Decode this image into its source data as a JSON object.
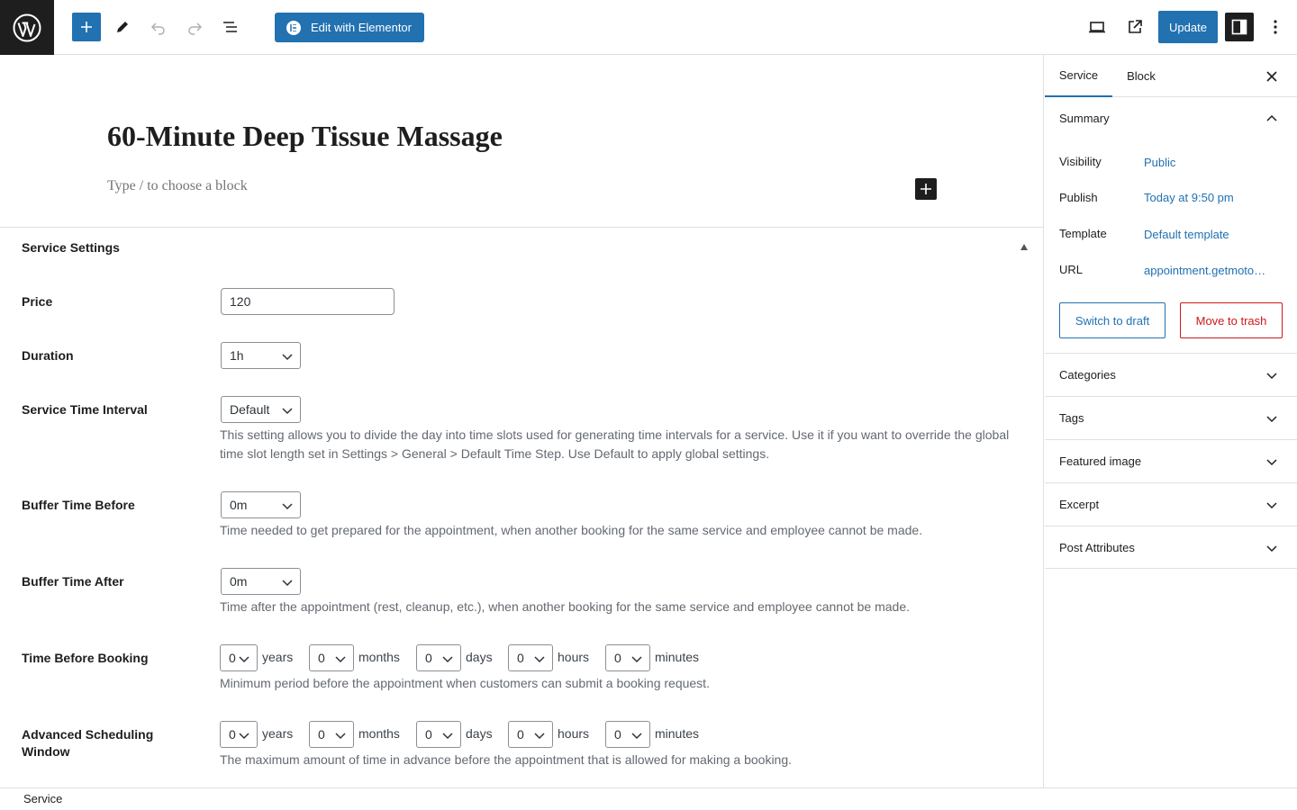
{
  "toolbar": {
    "elementor_label": "Edit with Elementor",
    "update_label": "Update"
  },
  "editor": {
    "title": "60-Minute Deep Tissue Massage",
    "placeholder": "Type / to choose a block"
  },
  "service_settings": {
    "header": "Service Settings",
    "price": {
      "label": "Price",
      "value": "120"
    },
    "duration": {
      "label": "Duration",
      "value": "1h"
    },
    "interval": {
      "label": "Service Time Interval",
      "value": "Default",
      "help_line1": "This setting allows you to divide the day into time slots used for generating time intervals for a service. Use it if you want to override the global",
      "help_line2": "time slot length set in Settings > General > Default Time Step. Use Default to apply global settings."
    },
    "buffer_before": {
      "label": "Buffer Time Before",
      "value": "0m",
      "help": "Time needed to get prepared for the appointment, when another booking for the same service and employee cannot be made."
    },
    "buffer_after": {
      "label": "Buffer Time After",
      "value": "0m",
      "help": "Time after the appointment (rest, cleanup, etc.), when another booking for the same service and employee cannot be made."
    },
    "time_before_booking": {
      "label": "Time Before Booking",
      "years": "0",
      "months": "0",
      "days": "0",
      "hours": "0",
      "minutes": "0",
      "help": "Minimum period before the appointment when customers can submit a booking request."
    },
    "advanced_window": {
      "label_line1": "Advanced Scheduling",
      "label_line2": "Window",
      "years": "0",
      "months": "0",
      "days": "0",
      "hours": "0",
      "minutes": "0",
      "help": "The maximum amount of time in advance before the appointment that is allowed for making a booking."
    },
    "units": {
      "years": "years",
      "months": "months",
      "days": "days",
      "hours": "hours",
      "minutes": "minutes"
    }
  },
  "sidebar": {
    "tabs": [
      "Service",
      "Block"
    ],
    "summary": {
      "title": "Summary",
      "visibility_label": "Visibility",
      "visibility_value": "Public",
      "publish_label": "Publish",
      "publish_value": "Today at 9:50 pm",
      "template_label": "Template",
      "template_value": "Default template",
      "url_label": "URL",
      "url_value": "appointment.getmoto…",
      "draft_label": "Switch to draft",
      "trash_label": "Move to trash"
    },
    "panels": [
      "Categories",
      "Tags",
      "Featured image",
      "Excerpt",
      "Post Attributes"
    ]
  },
  "footer": {
    "breadcrumb": "Service"
  },
  "colors": {
    "accent": "#2271b1",
    "danger": "#cc1818",
    "dark": "#1e1e1e"
  }
}
